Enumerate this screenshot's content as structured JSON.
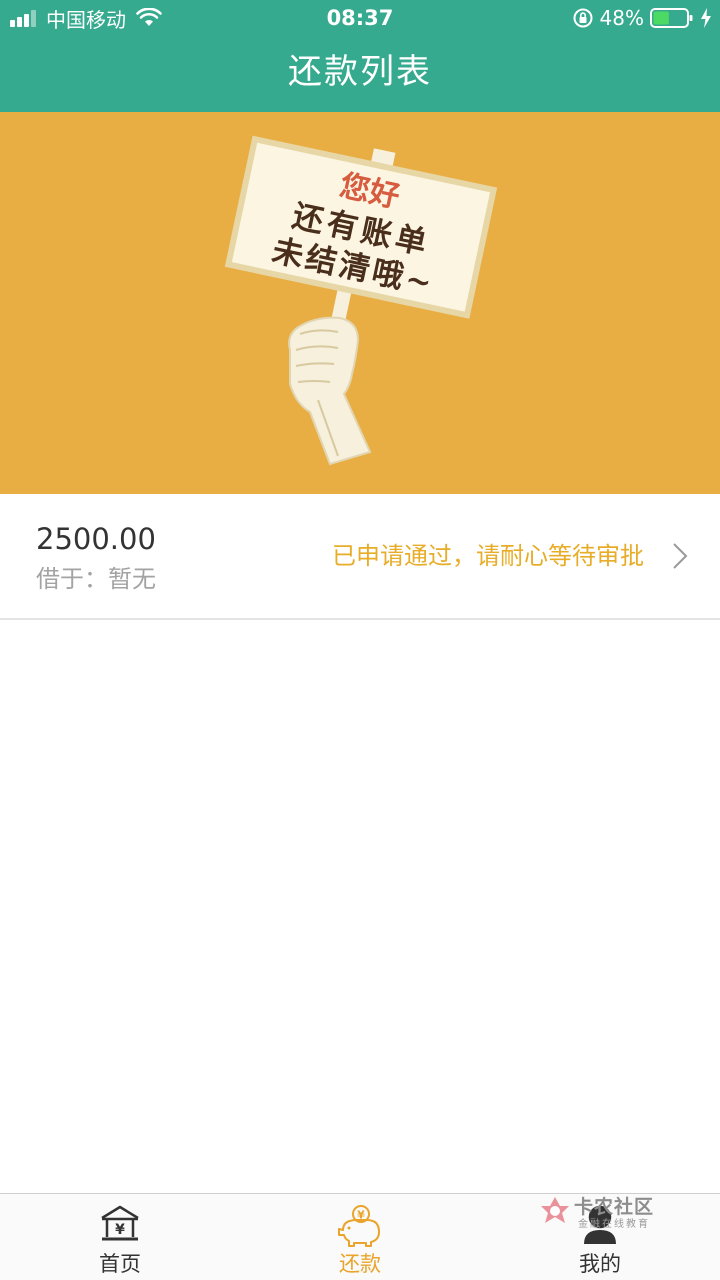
{
  "status_bar": {
    "carrier": "中国移动",
    "time": "08:37",
    "battery": "48%",
    "battery_level": 0.48
  },
  "header": {
    "title": "还款列表"
  },
  "banner": {
    "sign_line1": "您好",
    "sign_line2": "还有账单",
    "sign_line3": "未结清哦~"
  },
  "loans": [
    {
      "amount": "2500.00",
      "borrow_text": "借于：暂无",
      "status_text": "已申请通过，请耐心等待审批"
    }
  ],
  "tabbar": {
    "items": [
      {
        "label": "首页",
        "icon": "bank-icon",
        "active": false
      },
      {
        "label": "还款",
        "icon": "piggy-bank-icon",
        "active": true
      },
      {
        "label": "我的",
        "icon": "user-icon",
        "active": false
      }
    ]
  },
  "watermark": {
    "title": "卡农社区",
    "subtitle": "金融在线教育"
  },
  "colors": {
    "header_bg": "#35aa8e",
    "banner_bg": "#e9ae43",
    "status_accent": "#e8ad28",
    "tab_active": "#e9a429"
  }
}
